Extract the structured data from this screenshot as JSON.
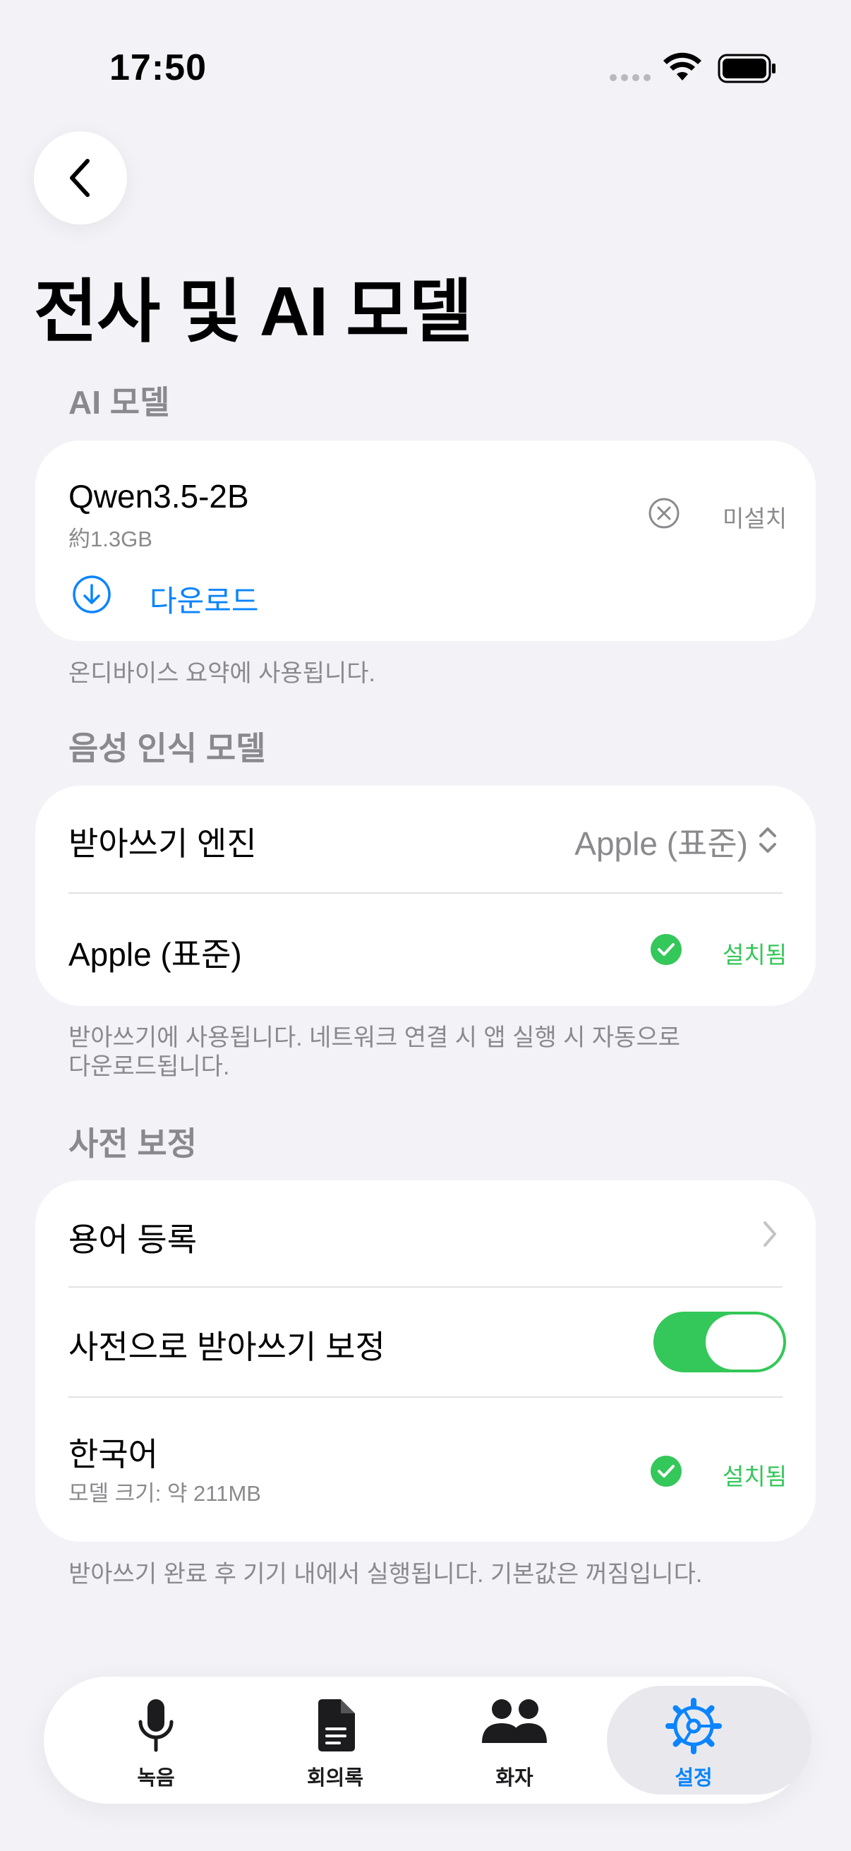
{
  "status_bar": {
    "time": "17:50"
  },
  "page_title": "전사 및 AI 모델",
  "ai_section": {
    "header": "AI 모델",
    "model_name": "Qwen3.5-2B",
    "model_size": "約1.3GB",
    "status": "미설치",
    "download_label": "다운로드",
    "footnote": "온디바이스 요약에 사용됩니다."
  },
  "speech_section": {
    "header": "음성 인식 모델",
    "engine_label": "받아쓰기 엔진",
    "engine_value": "Apple (표준)",
    "engine_item_label": "Apple (표준)",
    "engine_item_status": "설치됨",
    "footnote_line1": "받아쓰기에 사용됩니다. 네트워크 연결 시 앱 실행 시 자동으로",
    "footnote_line2": "다운로드됩니다."
  },
  "dictionary_section": {
    "header": "사전 보정",
    "term_label": "용어 등록",
    "toggle_label": "사전으로 받아쓰기 보정",
    "toggle_on": true,
    "language_label": "한국어",
    "language_sub": "모델 크기: 약 211MB",
    "language_status": "설치됨",
    "footnote": "받아쓰기 완료 후 기기 내에서 실행됩니다. 기본값은 꺼짐입니다."
  },
  "tabs": [
    {
      "label": "녹음",
      "icon": "mic-icon"
    },
    {
      "label": "회의록",
      "icon": "document-icon"
    },
    {
      "label": "화자",
      "icon": "people-icon"
    },
    {
      "label": "설정",
      "icon": "gear-icon",
      "active": true
    }
  ],
  "colors": {
    "accent": "#0a84ff",
    "success": "#34c759",
    "secondary_text": "#8a8a8e",
    "background": "#f2f2f7"
  }
}
